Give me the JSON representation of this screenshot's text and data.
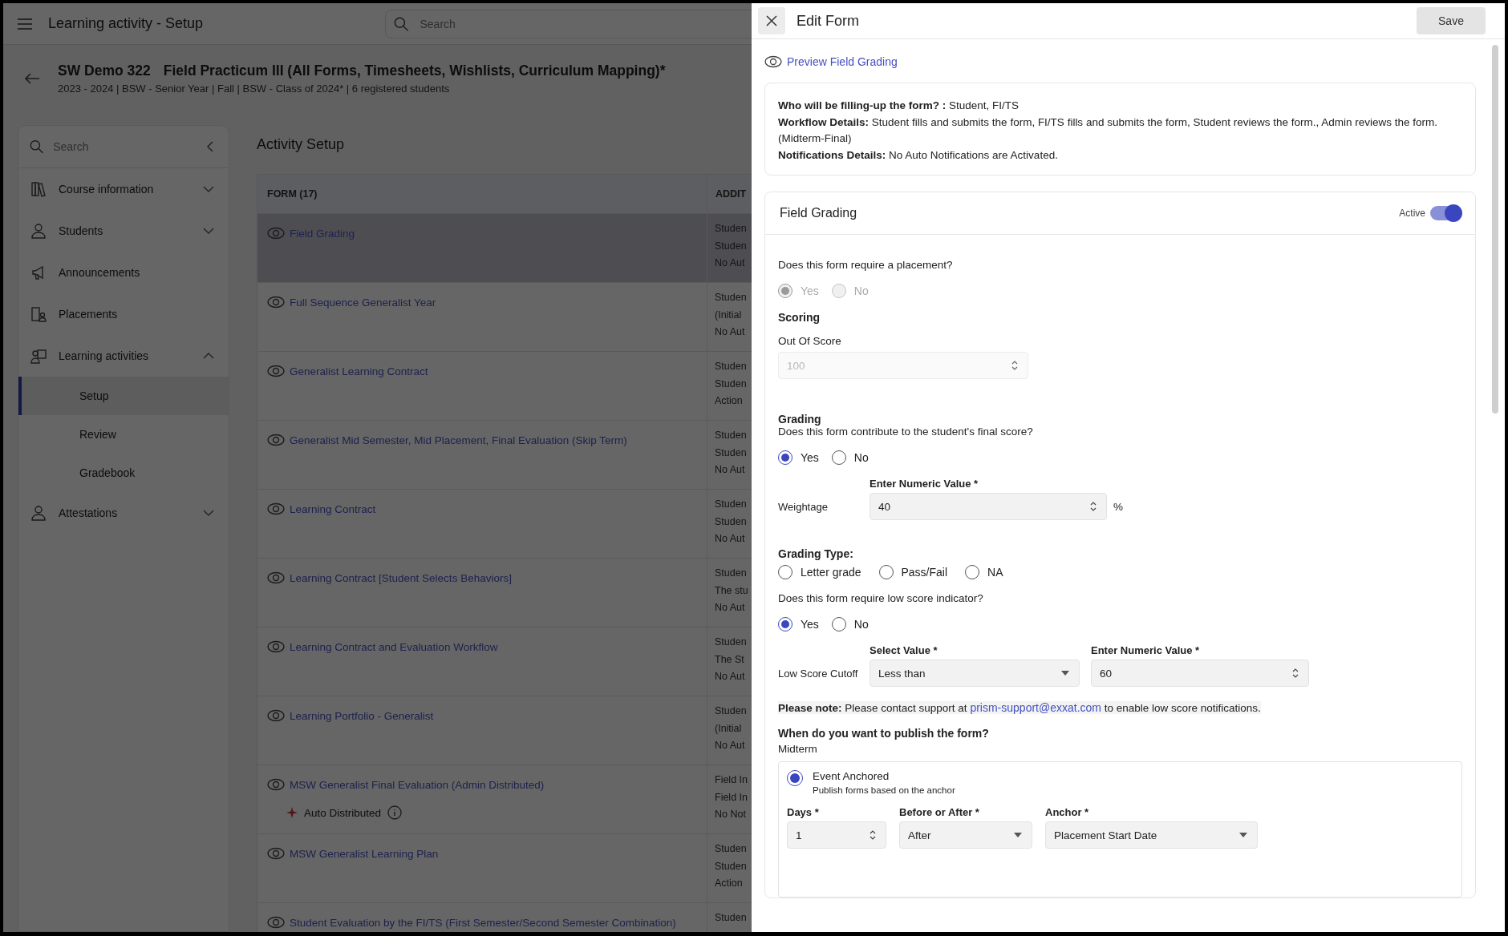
{
  "top_bar": {
    "title": "Learning activity - Setup",
    "search": {
      "placeholder": "Search"
    }
  },
  "course": {
    "code": "SW Demo 322",
    "name": "Field Practicum III (All Forms, Timesheets, Wishlists, Curriculum Mapping)*",
    "details": "2023 - 2024 | BSW - Senior Year | Fall | BSW - Class of 2024* | 6 registered students"
  },
  "sidebar": {
    "search": {
      "placeholder": "Search"
    },
    "items": [
      {
        "label": "Course information",
        "kind": "group",
        "expanded": false
      },
      {
        "label": "Students",
        "kind": "group",
        "expanded": false
      },
      {
        "label": "Announcements",
        "kind": "link"
      },
      {
        "label": "Placements",
        "kind": "link"
      },
      {
        "label": "Learning activities",
        "kind": "group",
        "expanded": true,
        "children": [
          {
            "label": "Setup",
            "selected": true
          },
          {
            "label": "Review",
            "selected": false
          },
          {
            "label": "Gradebook",
            "selected": false
          }
        ]
      },
      {
        "label": "Attestations",
        "kind": "group",
        "expanded": false
      }
    ]
  },
  "activity_setup": {
    "title": "Activity Setup",
    "table": {
      "columns": [
        "FORM (17)",
        "ADDIT"
      ],
      "rows": [
        {
          "form": "Field Grading",
          "selected": true,
          "additional": [
            "Studen",
            "Studen",
            "No Aut"
          ]
        },
        {
          "form": "Full Sequence Generalist Year",
          "selected": false,
          "additional": [
            "Studen",
            "(Initial",
            "No Aut"
          ]
        },
        {
          "form": "Generalist Learning Contract",
          "selected": false,
          "additional": [
            "Studen",
            "Studen",
            "Action"
          ]
        },
        {
          "form": "Generalist Mid Semester, Mid Placement, Final Evaluation (Skip Term)",
          "selected": false,
          "additional": [
            "Studen",
            "Studen",
            "No Aut"
          ]
        },
        {
          "form": "Learning Contract",
          "selected": false,
          "additional": [
            "Studen",
            "Studen",
            "No Aut"
          ]
        },
        {
          "form": "Learning Contract [Student Selects Behaviors]",
          "selected": false,
          "additional": [
            "Studen",
            "The stu",
            "No Aut"
          ]
        },
        {
          "form": "Learning Contract and Evaluation Workflow",
          "selected": false,
          "additional": [
            "Studen",
            "The St",
            "No Aut"
          ]
        },
        {
          "form": "Learning Portfolio - Generalist",
          "selected": false,
          "additional": [
            "Studen",
            "(Initial",
            "No Aut"
          ]
        },
        {
          "form": "MSW Generalist Final Evaluation (Admin Distributed)",
          "selected": false,
          "badge": "Auto Distributed",
          "additional": [
            "Field In",
            "Field In",
            "No Not"
          ]
        },
        {
          "form": "MSW Generalist Learning Plan",
          "selected": false,
          "additional": [
            "Studen",
            "Studen",
            "Action"
          ]
        },
        {
          "form": "Student Evaluation by the FI/TS (First Semester/Second Semester Combination)",
          "selected": false,
          "additional": [
            "Studen"
          ]
        }
      ]
    }
  },
  "edit_form": {
    "title": "Edit Form",
    "save_button": "Save",
    "preview_link": "Preview Field Grading",
    "info": [
      "**Who will be filling-up the form? :** Student, FI/TS",
      "**Workflow Details:** Student fills and submits the form, FI/TS fills and submits the form, Student reviews the form., Admin reviews the form. (Midterm-Final)",
      "**Notifications Details:** No Auto Notifications are Activated."
    ],
    "section": {
      "title": "Field Grading",
      "active_label": "Active",
      "active": true,
      "placement": {
        "question": "Does this form require a placement?",
        "disabled": true,
        "options": [
          {
            "label": "Yes",
            "selected": true
          },
          {
            "label": "No",
            "selected": false
          }
        ]
      },
      "scoring": {
        "heading": "Scoring",
        "label": "Out Of Score",
        "value": "100",
        "disabled": true
      },
      "grading": {
        "heading": "Grading",
        "question": "Does this form contribute to the student's final score?",
        "options": [
          {
            "label": "Yes",
            "selected": true
          },
          {
            "label": "No",
            "selected": false
          }
        ],
        "field_label": "Enter Numeric Value *",
        "weightage_label": "Weightage",
        "value": "40",
        "unit": "%"
      },
      "grading_type": {
        "heading": "Grading Type:",
        "options": [
          {
            "label": "Letter grade",
            "selected": false
          },
          {
            "label": "Pass/Fail",
            "selected": false
          },
          {
            "label": "NA",
            "selected": false
          }
        ]
      },
      "low_score": {
        "question": "Does this form require low score indicator?",
        "options": [
          {
            "label": "Yes",
            "selected": true
          },
          {
            "label": "No",
            "selected": false
          }
        ],
        "cutoff_label": "Low Score Cutoff",
        "select_label": "Select Value *",
        "select_value": "Less than",
        "numeric_label": "Enter Numeric Value *",
        "numeric_value": "60"
      },
      "note": {
        "label": "Please note:",
        "before": "Please contact support at",
        "link": "prism-support@exxat.com",
        "after": "to enable low score notifications."
      },
      "publish": {
        "question": "When do you want to publish the form?",
        "term": "Midterm",
        "option": {
          "label": "Event Anchored",
          "description": "Publish forms based on the anchor",
          "selected": true
        },
        "days_label": "Days *",
        "days_value": "1",
        "before_after_label": "Before or After *",
        "before_after_value": "After",
        "anchor_label": "Anchor *",
        "anchor_value": "Placement Start Date"
      }
    }
  }
}
